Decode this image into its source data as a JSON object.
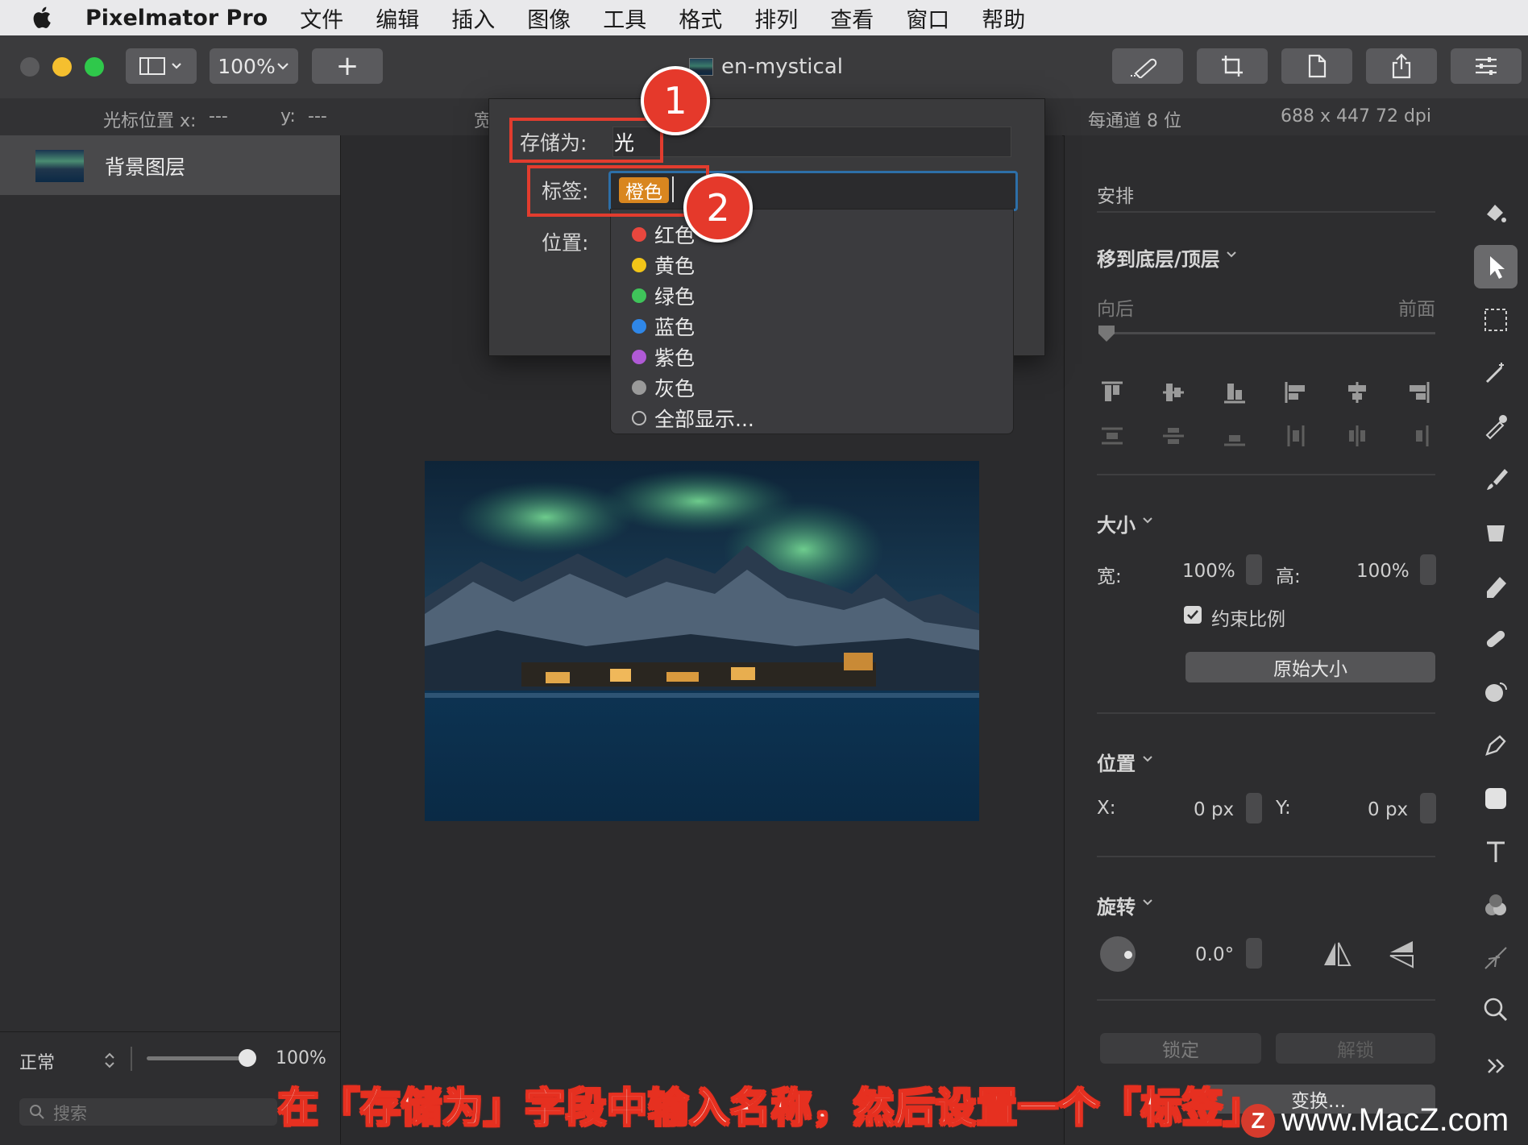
{
  "menubar": {
    "app_name": "Pixelmator Pro",
    "items": [
      "文件",
      "编辑",
      "插入",
      "图像",
      "工具",
      "格式",
      "排列",
      "查看",
      "窗口",
      "帮助"
    ]
  },
  "toolbar": {
    "zoom": "100%",
    "add": "+",
    "doc_title": "en-mystical"
  },
  "infobar": {
    "cursor_label": "光标位置 x:",
    "cursor_x": "---",
    "y_label": "y:",
    "cursor_y": "---",
    "width_label": "宽",
    "bits": "每通道 8 位",
    "dims": "688 x 447 72 dpi"
  },
  "layers": {
    "items": [
      {
        "name": "背景图层"
      }
    ],
    "blend_mode": "正常",
    "opacity": "100%",
    "opacity_value": 1.0,
    "search_placeholder": "搜索"
  },
  "dialog": {
    "saveas_label": "存储为:",
    "saveas_value": "光",
    "tags_label": "标签:",
    "tag_token": "橙色",
    "where_label": "位置:",
    "tag_options": [
      {
        "label": "红色",
        "color": "#e8473e"
      },
      {
        "label": "黄色",
        "color": "#f2c518"
      },
      {
        "label": "绿色",
        "color": "#3fc45a"
      },
      {
        "label": "蓝色",
        "color": "#2f87e8"
      },
      {
        "label": "紫色",
        "color": "#b05ad6"
      },
      {
        "label": "灰色",
        "color": "#9a9a9a"
      },
      {
        "label": "全部显示...",
        "color": "none"
      }
    ]
  },
  "annotations": {
    "badge1": "1",
    "badge2": "2"
  },
  "arrange": {
    "title": "安排",
    "move_label": "移到底层/顶层",
    "back_label": "向后",
    "front_label": "前面",
    "size_title": "大小",
    "width_label": "宽:",
    "width_value": "100%",
    "height_label": "高:",
    "height_value": "100%",
    "constrain_label": "约束比例",
    "constrain_checked": true,
    "original_size": "原始大小",
    "position_title": "位置",
    "x_label": "X:",
    "x_value": "0 px",
    "y_label": "Y:",
    "y_value": "0 px",
    "rotate_title": "旋转",
    "rotate_value": "0.0°",
    "lock": "锁定",
    "unlock": "解锁",
    "transform": "变换..."
  },
  "caption": "在「存储为」字段中输入名称，然后设置一个「标签」",
  "watermark": "www.MacZ.com",
  "watermark_logo": "Z"
}
